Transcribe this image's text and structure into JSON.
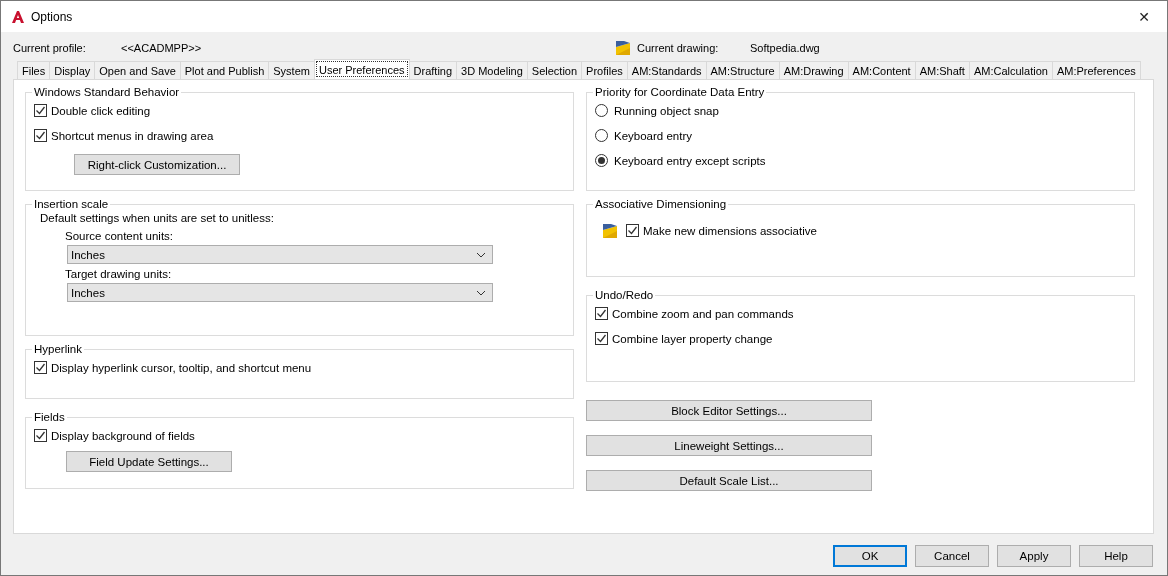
{
  "window": {
    "title": "Options",
    "close": "✕"
  },
  "profile": {
    "label": "Current profile:",
    "value": "<<ACADMPP>>"
  },
  "drawing": {
    "label": "Current drawing:",
    "value": "Softpedia.dwg"
  },
  "tabs": [
    {
      "label": "Files",
      "selected": false
    },
    {
      "label": "Display",
      "selected": false
    },
    {
      "label": "Open and Save",
      "selected": false
    },
    {
      "label": "Plot and Publish",
      "selected": false
    },
    {
      "label": "System",
      "selected": false
    },
    {
      "label": "User Preferences",
      "selected": true
    },
    {
      "label": "Drafting",
      "selected": false
    },
    {
      "label": "3D Modeling",
      "selected": false
    },
    {
      "label": "Selection",
      "selected": false
    },
    {
      "label": "Profiles",
      "selected": false
    },
    {
      "label": "AM:Standards",
      "selected": false
    },
    {
      "label": "AM:Structure",
      "selected": false
    },
    {
      "label": "AM:Drawing",
      "selected": false
    },
    {
      "label": "AM:Content",
      "selected": false
    },
    {
      "label": "AM:Shaft",
      "selected": false
    },
    {
      "label": "AM:Calculation",
      "selected": false
    },
    {
      "label": "AM:Preferences",
      "selected": false
    }
  ],
  "left_groups": [
    {
      "title": "Windows Standard Behavior",
      "items": [
        {
          "kind": "checkbox",
          "label": "Double click editing",
          "checked": true
        },
        {
          "kind": "checkbox",
          "label": "Shortcut menus in drawing area",
          "checked": true
        },
        {
          "kind": "button",
          "label": "Right-click Customization..."
        }
      ]
    },
    {
      "title": "Insertion scale",
      "items": [
        {
          "kind": "note",
          "label": "Default settings when units are set to unitless:"
        },
        {
          "kind": "dropdown",
          "label": "Source content units:",
          "value": "Inches"
        },
        {
          "kind": "dropdown",
          "label": "Target drawing units:",
          "value": "Inches"
        }
      ]
    },
    {
      "title": "Hyperlink",
      "items": [
        {
          "kind": "checkbox",
          "label": "Display hyperlink cursor, tooltip, and shortcut menu",
          "checked": true
        }
      ]
    },
    {
      "title": "Fields",
      "items": [
        {
          "kind": "checkbox",
          "label": "Display background of fields",
          "checked": true
        },
        {
          "kind": "button",
          "label": "Field Update Settings..."
        }
      ]
    }
  ],
  "right_groups": [
    {
      "title": "Priority for Coordinate Data Entry",
      "items": [
        {
          "kind": "radio",
          "label": "Running object snap",
          "selected": false
        },
        {
          "kind": "radio",
          "label": "Keyboard entry",
          "selected": false
        },
        {
          "kind": "radio",
          "label": "Keyboard entry except scripts",
          "selected": true
        }
      ]
    },
    {
      "title": "Associative Dimensioning",
      "items": [
        {
          "kind": "icon_checkbox",
          "label": "Make new dimensions associative",
          "checked": true
        }
      ]
    },
    {
      "title": "Undo/Redo",
      "items": [
        {
          "kind": "checkbox",
          "label": "Combine zoom and pan commands",
          "checked": true
        },
        {
          "kind": "checkbox",
          "label": "Combine layer property change",
          "checked": true
        }
      ]
    }
  ],
  "right_buttons": [
    "Block Editor Settings...",
    "Lineweight Settings...",
    "Default Scale List..."
  ],
  "footer_buttons": [
    {
      "label": "OK",
      "default": true
    },
    {
      "label": "Cancel",
      "default": false
    },
    {
      "label": "Apply",
      "default": false
    },
    {
      "label": "Help",
      "default": false
    }
  ]
}
